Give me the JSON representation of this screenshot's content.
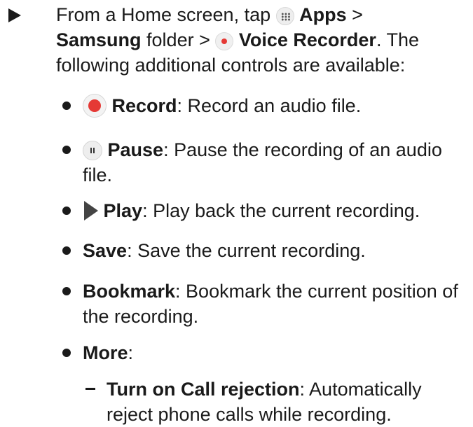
{
  "intro": {
    "prefix": "From a Home screen, tap",
    "apps_label": "Apps",
    "sep1": " >",
    "samsung_label": "Samsung",
    "folder_text": " folder > ",
    "voice_recorder_label": "Voice Recorder",
    "suffix": ". The following additional controls are available:"
  },
  "items": [
    {
      "label": "Record",
      "desc": ": Record an audio file.",
      "icon": "record-icon"
    },
    {
      "label": "Pause",
      "desc": ": Pause the recording of an audio file.",
      "icon": "pause-icon"
    },
    {
      "label": "Play",
      "desc": ": Play back the current recording.",
      "icon": "play-icon"
    },
    {
      "label": "Save",
      "desc": ": Save the current recording."
    },
    {
      "label": "Bookmark",
      "desc": ": Bookmark the current position of the recording."
    },
    {
      "label": "More",
      "desc": ":"
    }
  ],
  "subitems": [
    {
      "label": "Turn on Call rejection",
      "desc": ": Automatically reject phone calls while recording."
    }
  ],
  "colors": {
    "record_red": "#e53935",
    "text": "#1a1a1a"
  }
}
